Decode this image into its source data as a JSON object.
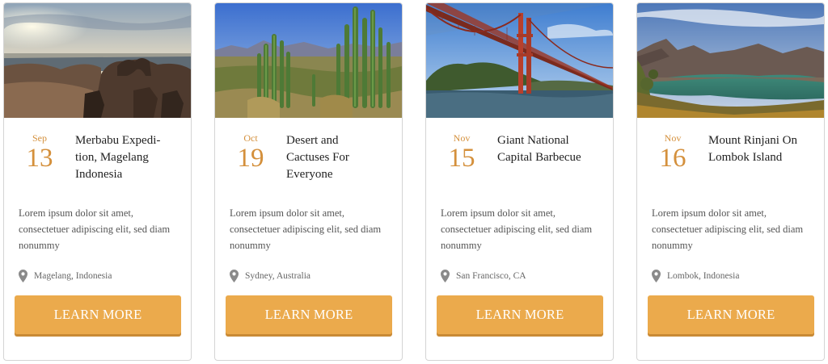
{
  "events": [
    {
      "month": "Sep",
      "day": "13",
      "title": "Merbabu Expedi-tion, Magelang Indonesia",
      "description": "Lorem ipsum dolor sit amet, consectetuer adipiscing elit, sed diam nonummy",
      "location": "Magelang, Indonesia",
      "button_label": "LEARN MORE"
    },
    {
      "month": "Oct",
      "day": "19",
      "title": "Desert and Cactuses For Everyone",
      "description": "Lorem ipsum dolor sit amet, consectetuer adipiscing elit, sed diam nonummy",
      "location": "Sydney, Australia",
      "button_label": "LEARN MORE"
    },
    {
      "month": "Nov",
      "day": "15",
      "title": "Giant National Capital Barbecue",
      "description": "Lorem ipsum dolor sit amet, consectetuer adipiscing elit, sed diam nonummy",
      "location": "San Francisco, CA",
      "button_label": "LEARN MORE"
    },
    {
      "month": "Nov",
      "day": "16",
      "title": "Mount Rinjani On Lombok Island",
      "description": "Lorem ipsum dolor sit amet, consectetuer adipiscing elit, sed diam nonummy",
      "location": "Lombok, Indonesia",
      "button_label": "LEARN MORE"
    }
  ],
  "icons": {
    "location": "map-pin-icon"
  },
  "colors": {
    "accent": "#d4903c",
    "button": "#ebaa4c",
    "button_shadow": "#c98a35"
  }
}
